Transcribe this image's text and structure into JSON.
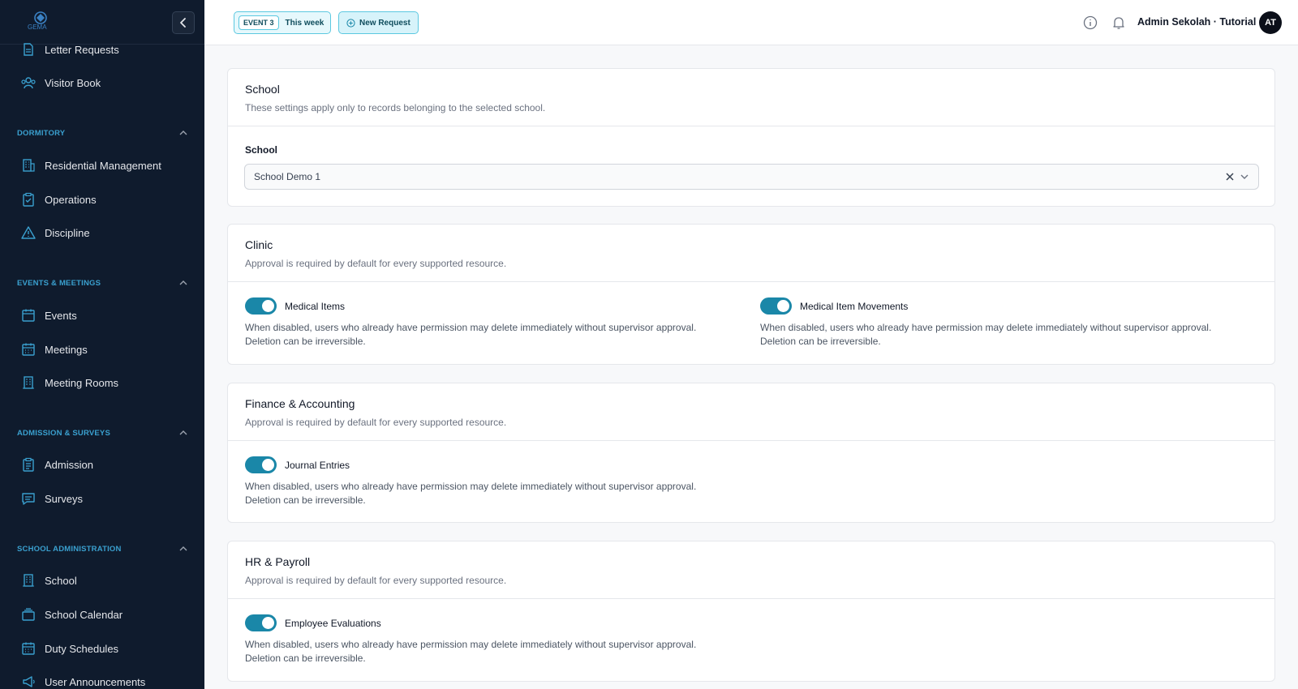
{
  "sidebar": {
    "logo_text": "GEMA",
    "items_top": [
      {
        "label": "Letter Requests",
        "icon": "document-icon"
      },
      {
        "label": "Visitor Book",
        "icon": "users-icon"
      }
    ],
    "sections": [
      {
        "title": "DORMITORY",
        "items": [
          {
            "label": "Residential Management",
            "icon": "building-icon"
          },
          {
            "label": "Operations",
            "icon": "clipboard-check-icon"
          },
          {
            "label": "Discipline",
            "icon": "warning-icon"
          }
        ]
      },
      {
        "title": "EVENTS & MEETINGS",
        "items": [
          {
            "label": "Events",
            "icon": "calendar-icon"
          },
          {
            "label": "Meetings",
            "icon": "calendar-grid-icon"
          },
          {
            "label": "Meeting Rooms",
            "icon": "building-icon"
          }
        ]
      },
      {
        "title": "ADMISSION & SURVEYS",
        "items": [
          {
            "label": "Admission",
            "icon": "clipboard-list-icon"
          },
          {
            "label": "Surveys",
            "icon": "chat-icon"
          }
        ]
      },
      {
        "title": "SCHOOL ADMINISTRATION",
        "items": [
          {
            "label": "School",
            "icon": "building-icon"
          },
          {
            "label": "School Calendar",
            "icon": "stack-icon"
          },
          {
            "label": "Duty Schedules",
            "icon": "calendar-grid-icon"
          },
          {
            "label": "User Announcements",
            "icon": "megaphone-icon"
          }
        ]
      }
    ]
  },
  "topbar": {
    "event_badge": "EVENT 3",
    "event_period": "This week",
    "new_request": "New Request",
    "user_name": "Admin Sekolah · Tutorial",
    "avatar_initials": "AT"
  },
  "school_card": {
    "title": "School",
    "description": "These settings apply only to records belonging to the selected school.",
    "field_label": "School",
    "selected_value": "School Demo 1"
  },
  "clinic_card": {
    "title": "Clinic",
    "description": "Approval is required by default for every supported resource.",
    "toggles": [
      {
        "label": "Medical Items",
        "enabled": true,
        "desc1": "When disabled, users who already have permission may delete immediately without supervisor approval.",
        "desc2": "Deletion can be irreversible."
      },
      {
        "label": "Medical Item Movements",
        "enabled": true,
        "desc1": "When disabled, users who already have permission may delete immediately without supervisor approval.",
        "desc2": "Deletion can be irreversible."
      }
    ]
  },
  "finance_card": {
    "title": "Finance & Accounting",
    "description": "Approval is required by default for every supported resource.",
    "toggles": [
      {
        "label": "Journal Entries",
        "enabled": true,
        "desc1": "When disabled, users who already have permission may delete immediately without supervisor approval.",
        "desc2": "Deletion can be irreversible."
      }
    ]
  },
  "hr_card": {
    "title": "HR & Payroll",
    "description": "Approval is required by default for every supported resource.",
    "toggles": [
      {
        "label": "Employee Evaluations",
        "enabled": true,
        "desc1": "When disabled, users who already have permission may delete immediately without supervisor approval.",
        "desc2": "Deletion can be irreversible."
      }
    ]
  },
  "colors": {
    "sidebar_bg": "#0f1b2d",
    "section_header": "#3aa0cf",
    "toggle_on": "#1a87a8",
    "chip_border": "#5cc8e0"
  }
}
